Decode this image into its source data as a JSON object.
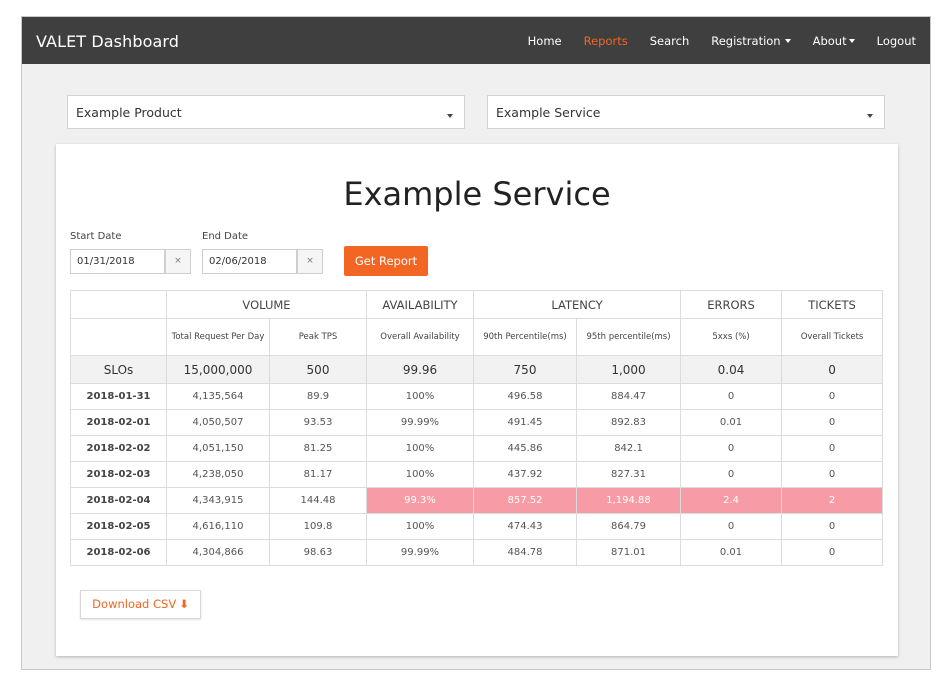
{
  "navbar": {
    "brand": "VALET Dashboard",
    "items": [
      {
        "label": "Home",
        "active": false,
        "dropdown": false
      },
      {
        "label": "Reports",
        "active": true,
        "dropdown": false
      },
      {
        "label": "Search",
        "active": false,
        "dropdown": false
      },
      {
        "label": "Registration",
        "active": false,
        "dropdown": true
      },
      {
        "label": "About",
        "active": false,
        "dropdown": true
      },
      {
        "label": "Logout",
        "active": false,
        "dropdown": false
      }
    ]
  },
  "filters": {
    "product": "Example Product",
    "service": "Example Service"
  },
  "report": {
    "title": "Example Service",
    "start_label": "Start Date",
    "start_value": "01/31/2018",
    "end_label": "End Date",
    "end_value": "02/06/2018",
    "clear_glyph": "×",
    "get_report_label": "Get Report",
    "download_label": "Download CSV",
    "download_icon": "arrow-down-icon"
  },
  "table": {
    "groups": [
      "VOLUME",
      "AVAILABILITY",
      "LATENCY",
      "ERRORS",
      "TICKETS"
    ],
    "subheaders": [
      "Total Request Per Day",
      "Peak TPS",
      "Overall Availability",
      "90th Percentile(ms)",
      "95th percentile(ms)",
      "5xxs (%)",
      "Overall Tickets"
    ],
    "slo": {
      "label": "SLOs",
      "values": [
        "15,000,000",
        "500",
        "99.96",
        "750",
        "1,000",
        "0.04",
        "0"
      ]
    },
    "rows": [
      {
        "date": "2018-01-31",
        "values": [
          "4,135,564",
          "89.9",
          "100%",
          "496.58",
          "884.47",
          "0",
          "0"
        ],
        "alert": false
      },
      {
        "date": "2018-02-01",
        "values": [
          "4,050,507",
          "93.53",
          "99.99%",
          "491.45",
          "892.83",
          "0.01",
          "0"
        ],
        "alert": false
      },
      {
        "date": "2018-02-02",
        "values": [
          "4,051,150",
          "81.25",
          "100%",
          "445.86",
          "842.1",
          "0",
          "0"
        ],
        "alert": false
      },
      {
        "date": "2018-02-03",
        "values": [
          "4,238,050",
          "81.17",
          "100%",
          "437.92",
          "827.31",
          "0",
          "0"
        ],
        "alert": false
      },
      {
        "date": "2018-02-04",
        "values": [
          "4,343,915",
          "144.48",
          "99.3%",
          "857.52",
          "1,194.88",
          "2.4",
          "2"
        ],
        "alert": true
      },
      {
        "date": "2018-02-05",
        "values": [
          "4,616,110",
          "109.8",
          "100%",
          "474.43",
          "864.79",
          "0",
          "0"
        ],
        "alert": false
      },
      {
        "date": "2018-02-06",
        "values": [
          "4,304,866",
          "98.63",
          "99.99%",
          "484.78",
          "871.01",
          "0.01",
          "0"
        ],
        "alert": false
      }
    ]
  },
  "colors": {
    "accent": "#f26522",
    "navbar_bg": "#3f3f3f",
    "alert_row": "#f79ca6"
  }
}
